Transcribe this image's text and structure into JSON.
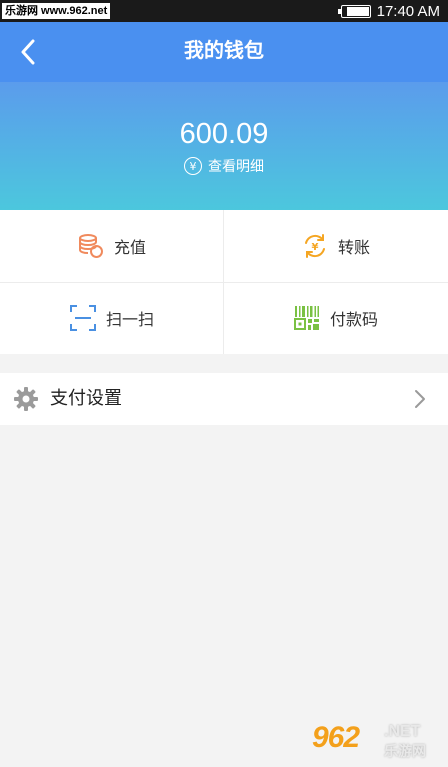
{
  "statusbar": {
    "watermark": "乐游网 www.962.net",
    "battery_level": 0.85,
    "time": "17:40 AM"
  },
  "header": {
    "title": "我的钱包",
    "back_icon": "chevron-left-icon"
  },
  "balance": {
    "amount": "600.09",
    "detail_label": "查看明细",
    "detail_icon": "yen-circle-icon",
    "yen_symbol": "¥"
  },
  "grid": {
    "items": [
      {
        "label": "充值",
        "icon": "coins-stack-icon",
        "color": "#f08a5d"
      },
      {
        "label": "转账",
        "icon": "transfer-yen-icon",
        "color": "#f5a623"
      },
      {
        "label": "扫一扫",
        "icon": "scan-frame-icon",
        "color": "#4a90e2"
      },
      {
        "label": "付款码",
        "icon": "barcode-qr-icon",
        "color": "#7ac143"
      }
    ]
  },
  "settings": {
    "label": "支付设置",
    "icon": "gear-icon",
    "arrow_icon": "chevron-right-icon"
  },
  "footer_watermark": {
    "number": "962",
    "domain": ".NET",
    "name": "乐游网"
  },
  "colors": {
    "header": "#4a90f0",
    "gradient_top": "#5b9cec",
    "gradient_bottom": "#4cc7dd",
    "background": "#f3f3f3"
  }
}
